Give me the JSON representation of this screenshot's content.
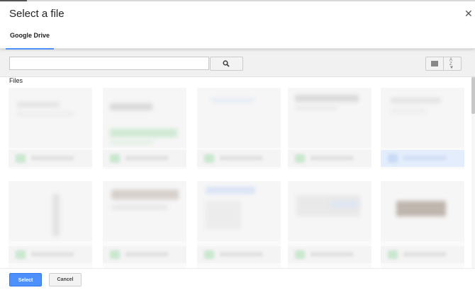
{
  "dialog": {
    "title": "Select a file",
    "close_icon": "close-icon"
  },
  "tabs": [
    {
      "label": "Google Drive",
      "active": true
    }
  ],
  "toolbar": {
    "search_value": "",
    "search_placeholder": "",
    "search_icon": "search-icon",
    "list_view_icon": "list-view-icon",
    "sort_icon": "sort-az-icon"
  },
  "files": {
    "heading": "Files",
    "grid_rows": 2,
    "grid_columns": 5,
    "selected_item_index": 4
  },
  "footer": {
    "select_label": "Select",
    "cancel_label": "Cancel"
  },
  "colors": {
    "accent": "#4d90fe",
    "toolbar_bg": "#f1f1f1",
    "selected_caption_bg": "#e3edfb"
  }
}
